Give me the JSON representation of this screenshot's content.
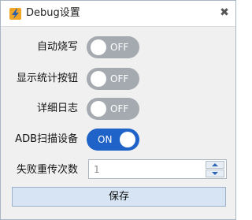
{
  "window": {
    "title": "Debug设置",
    "close_symbol": "✖"
  },
  "icons": {
    "app": "lightning-app-icon",
    "close": "close-icon"
  },
  "settings": [
    {
      "label": "自动烧写",
      "state": "OFF",
      "on": false
    },
    {
      "label": "显示统计按钮",
      "state": "OFF",
      "on": false
    },
    {
      "label": "详细日志",
      "state": "OFF",
      "on": false
    },
    {
      "label": "ADB扫描设备",
      "state": "ON",
      "on": true
    }
  ],
  "fail_retry": {
    "label": "失败重传次数",
    "value": "1"
  },
  "save_button": {
    "label": "保存"
  },
  "colors": {
    "toggle_on": "#1f63c8",
    "toggle_off": "#a4aab0",
    "accent_icon": "#2d67b6"
  }
}
